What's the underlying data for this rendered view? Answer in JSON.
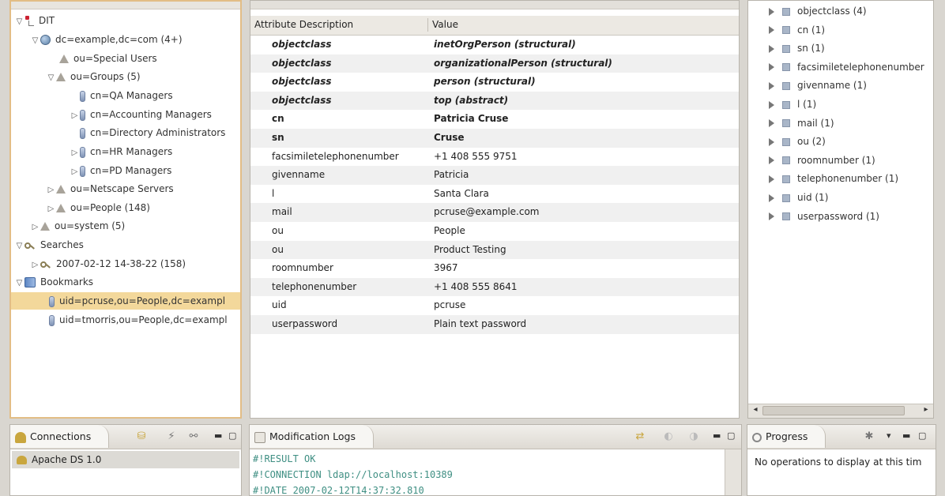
{
  "dit": {
    "rows": [
      {
        "label": "DIT"
      },
      {
        "label": "dc=example,dc=com (4+)"
      },
      {
        "label": "ou=Special Users"
      },
      {
        "label": "ou=Groups (5)"
      },
      {
        "label": "cn=QA Managers"
      },
      {
        "label": "cn=Accounting Managers"
      },
      {
        "label": "cn=Directory Administrators"
      },
      {
        "label": "cn=HR Managers"
      },
      {
        "label": "cn=PD Managers"
      },
      {
        "label": "ou=Netscape Servers"
      },
      {
        "label": "ou=People (148)"
      },
      {
        "label": "ou=system (5)"
      },
      {
        "label": "Searches"
      },
      {
        "label": "2007-02-12 14-38-22 (158)"
      },
      {
        "label": "Bookmarks"
      },
      {
        "label": "uid=pcruse,ou=People,dc=exampl"
      },
      {
        "label": "uid=tmorris,ou=People,dc=exampl"
      }
    ]
  },
  "editor": {
    "columns": {
      "attribute": "Attribute Description",
      "value": "Value"
    },
    "rows": [
      {
        "key": "objectclass",
        "value": "inetOrgPerson (structural)"
      },
      {
        "key": "objectclass",
        "value": "organizationalPerson (structural)"
      },
      {
        "key": "objectclass",
        "value": "person (structural)"
      },
      {
        "key": "objectclass",
        "value": "top (abstract)"
      },
      {
        "key": "cn",
        "value": "Patricia Cruse"
      },
      {
        "key": "sn",
        "value": "Cruse"
      },
      {
        "key": "facsimiletelephonenumber",
        "value": "+1 408 555 9751"
      },
      {
        "key": "givenname",
        "value": "Patricia"
      },
      {
        "key": "l",
        "value": "Santa Clara"
      },
      {
        "key": "mail",
        "value": "pcruse@example.com"
      },
      {
        "key": "ou",
        "value": "People"
      },
      {
        "key": "ou",
        "value": "Product Testing"
      },
      {
        "key": "roomnumber",
        "value": "3967"
      },
      {
        "key": "telephonenumber",
        "value": "+1 408 555 8641"
      },
      {
        "key": "uid",
        "value": "pcruse"
      },
      {
        "key": "userpassword",
        "value": "Plain text password"
      }
    ]
  },
  "outline": {
    "items": [
      {
        "label": "objectclass (4)"
      },
      {
        "label": "cn (1)"
      },
      {
        "label": "sn (1)"
      },
      {
        "label": "facsimiletelephonenumber"
      },
      {
        "label": "givenname (1)"
      },
      {
        "label": "l (1)"
      },
      {
        "label": "mail (1)"
      },
      {
        "label": "ou (2)"
      },
      {
        "label": "roomnumber (1)"
      },
      {
        "label": "telephonenumber (1)"
      },
      {
        "label": "uid (1)"
      },
      {
        "label": "userpassword (1)"
      }
    ]
  },
  "connections": {
    "tab_label": "Connections",
    "items": [
      {
        "label": "Apache DS 1.0"
      }
    ]
  },
  "modlogs": {
    "tab_label": "Modification Logs",
    "lines": [
      "#!RESULT OK",
      "#!CONNECTION ldap://localhost:10389",
      "#!DATE 2007-02-12T14:37:32.810"
    ]
  },
  "progress": {
    "tab_label": "Progress",
    "empty_text": "No operations to display at this tim"
  },
  "colors": {
    "selection": "#f3d89b",
    "active_border": "#e2bd86",
    "log_text": "#3f8f83"
  }
}
